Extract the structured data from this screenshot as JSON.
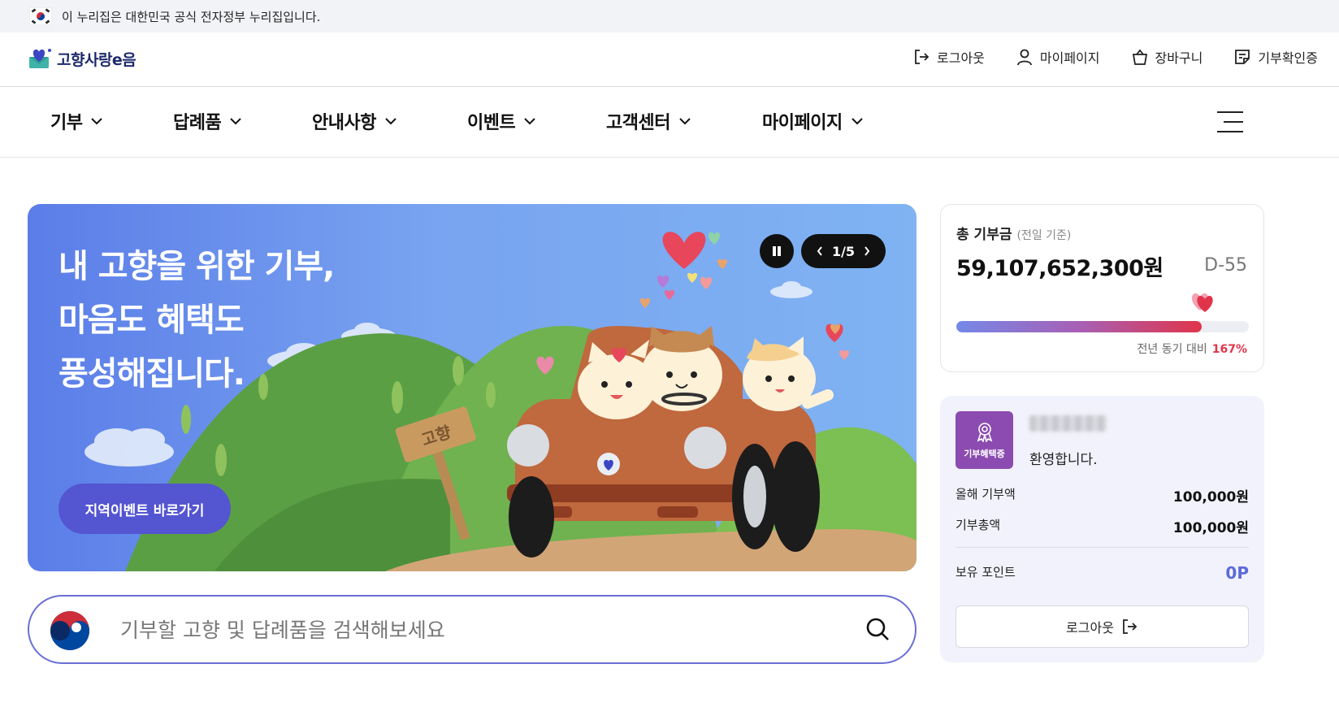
{
  "gov_banner": {
    "text": "이 누리집은 대한민국 공식 전자정부 누리집입니다."
  },
  "header": {
    "logo_text": "고향사랑e음",
    "util": [
      {
        "label": "로그아웃",
        "icon": "logout-icon"
      },
      {
        "label": "마이페이지",
        "icon": "user-icon"
      },
      {
        "label": "장바구니",
        "icon": "cart-icon"
      },
      {
        "label": "기부확인증",
        "icon": "certificate-icon"
      }
    ]
  },
  "gnb": {
    "items": [
      {
        "label": "기부"
      },
      {
        "label": "답례품"
      },
      {
        "label": "안내사항"
      },
      {
        "label": "이벤트"
      },
      {
        "label": "고객센터"
      },
      {
        "label": "마이페이지"
      }
    ],
    "menu_icon": "hamburger-icon"
  },
  "hero": {
    "title_lines": [
      "내 고향을 위한 기부,",
      "마음도 혜택도",
      "풍성해집니다."
    ],
    "button_label": "지역이벤트 바로가기",
    "sign_text": "고향",
    "pager": {
      "current": "1",
      "total": "/5"
    }
  },
  "search": {
    "placeholder": "기부할 고향 및 답례품을 검색해보세요",
    "value": ""
  },
  "total_donation": {
    "label": "총 기부금",
    "sub_label": "(전일 기준)",
    "amount": "59,107,652,300원",
    "dday": "D-55",
    "progress_fraction": 0.84,
    "yoy_label": "전년 동기 대비",
    "yoy_value": "167%"
  },
  "user_panel": {
    "badge_label": "기부혜택증",
    "welcome": "환영합니다.",
    "this_year_label": "올해 기부액",
    "this_year_value": "100,000원",
    "total_label": "기부총액",
    "total_value": "100,000원",
    "points_label": "보유 포인트",
    "points_value": "0P",
    "logout_label": "로그아웃"
  },
  "colors": {
    "accent": "#5355d1",
    "search_border": "#6a6fd6",
    "progress_end": "#e0344a",
    "user_card_bg": "#f1f2fb",
    "badge_bg": "#8b4bb0"
  }
}
